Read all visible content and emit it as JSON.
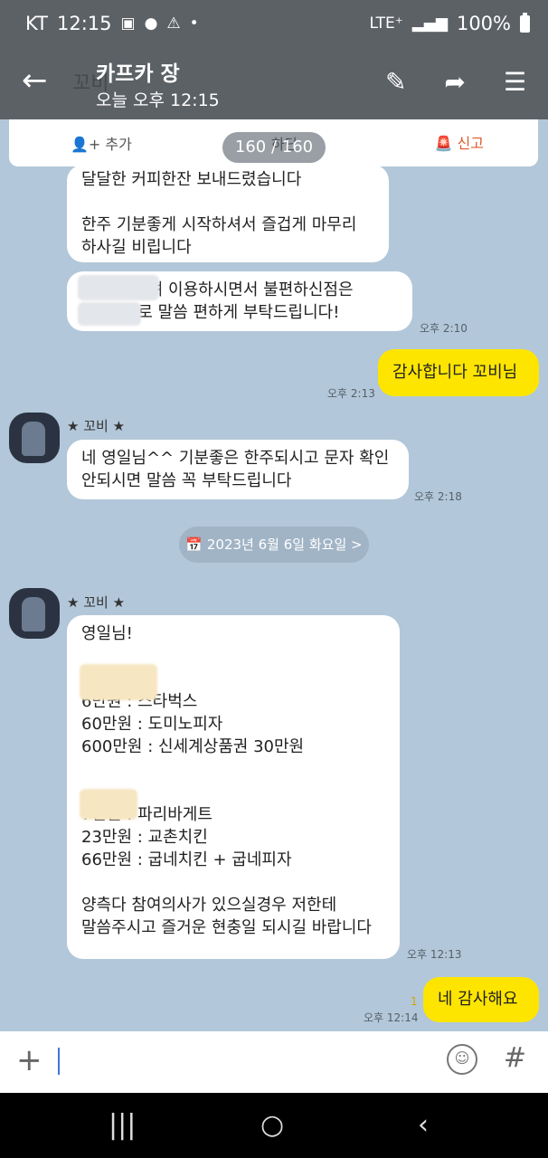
{
  "status": {
    "carrier": "KT",
    "time": "12:15",
    "network": "LTE⁺",
    "battery": "100%"
  },
  "header": {
    "title": "카프카 장",
    "subtitle": "오늘 오후 12:15",
    "bg_text": "꼬비"
  },
  "toolbar": {
    "add": "추가",
    "middle": "하단",
    "report": "신고"
  },
  "counter": "160 / 160",
  "messages": {
    "m1": "달달한 커피한잔 보내드렸습니다\n\n한주 기분좋게 시작하셔서 즐겁게 마무리\n하사길 비립니다",
    "m2": "          이며 이용하시면서 불편하신점은\n        으로 말씀 편하게 부탁드립니다!",
    "m2_time": "오후 2:10",
    "m3": "감사합니다 꼬비님",
    "m3_time": "오후 2:13",
    "name1": "꼬비",
    "m4": "네 영일님^^ 기분좋은 한주되시고 문자 확인\n안되시면 말씀 꼭 부탁드립니다",
    "m4_time": "오후 2:18",
    "date": "2023년 6월 6일 화요일 >",
    "name2": "꼬비",
    "m5": "영일님!\n\n\n6만원 : 스타벅스\n60만원 : 도미노피자\n600만원 : 신세계상품권 30만원\n\n\n7만원 : 파리바게트\n23만원 : 교촌치킨\n66만원 : 굽네치킨 + 굽네피자\n\n양측다 참여의사가 있으실경우 저한테\n말씀주시고 즐거운 현충일 되시길 바랍니다",
    "m5_time": "오후 12:13",
    "m6": "네 감사해요",
    "m6_time": "오후 12:14",
    "m6_read": "1"
  },
  "input": {
    "plus": "+",
    "hash": "#"
  }
}
